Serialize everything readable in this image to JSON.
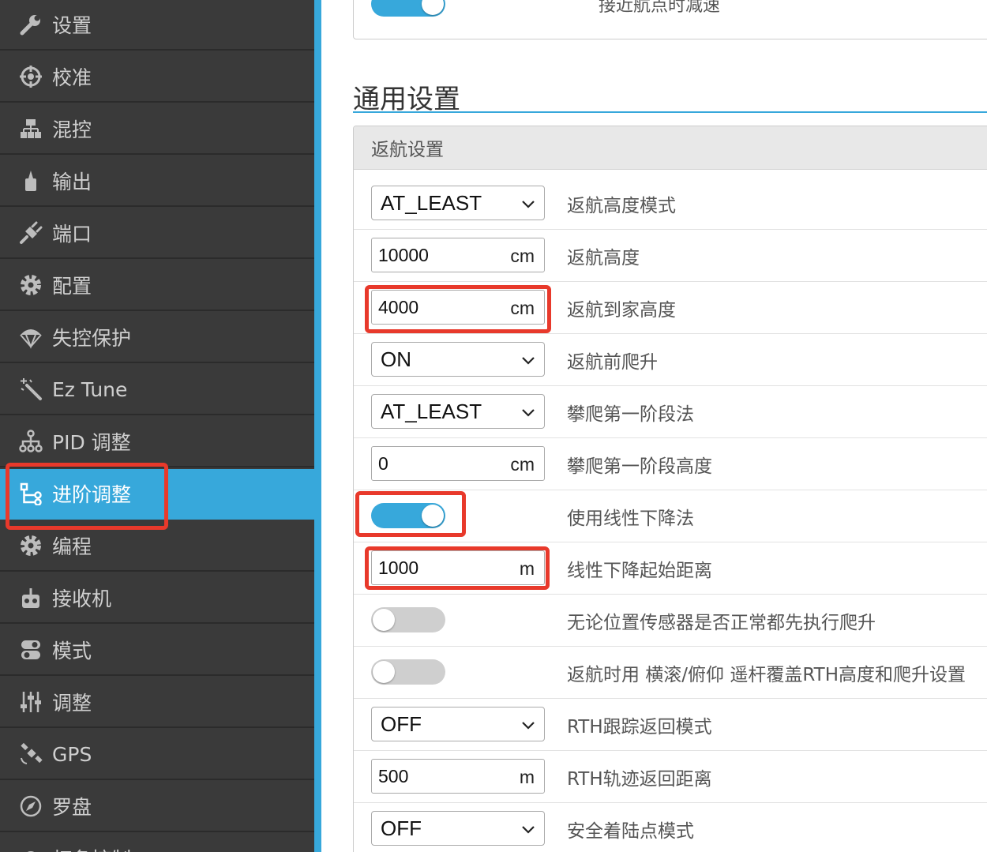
{
  "sidebar": {
    "items": [
      {
        "label": "设置",
        "icon": "wrench-icon"
      },
      {
        "label": "校准",
        "icon": "crosshair-icon"
      },
      {
        "label": "混控",
        "icon": "mixer-icon"
      },
      {
        "label": "输出",
        "icon": "motor-icon"
      },
      {
        "label": "端口",
        "icon": "plug-icon"
      },
      {
        "label": "配置",
        "icon": "gear-icon"
      },
      {
        "label": "失控保护",
        "icon": "parachute-icon"
      },
      {
        "label": "Ez Tune",
        "icon": "magic-wand-icon"
      },
      {
        "label": "PID 调整",
        "icon": "pid-tree-icon"
      },
      {
        "label": "进阶调整",
        "icon": "advanced-tuning-icon"
      },
      {
        "label": "编程",
        "icon": "gear-icon"
      },
      {
        "label": "接收机",
        "icon": "receiver-icon"
      },
      {
        "label": "模式",
        "icon": "toggle-switch-icon"
      },
      {
        "label": "调整",
        "icon": "sliders-icon"
      },
      {
        "label": "GPS",
        "icon": "satellite-icon"
      },
      {
        "label": "罗盘",
        "icon": "compass-icon"
      },
      {
        "label": "灯条控制",
        "icon": "led-icon"
      }
    ],
    "active_label": "进阶调整",
    "accent_color": "#37a8db"
  },
  "main": {
    "top_panel": {
      "label": "接近航点时减速",
      "toggle_state": "on"
    },
    "section_title": "通用设置",
    "panel": {
      "header": "返航设置",
      "rows": [
        {
          "type": "select",
          "value": "AT_LEAST",
          "label": "返航高度模式"
        },
        {
          "type": "number",
          "value": "10000",
          "unit": "cm",
          "label": "返航高度"
        },
        {
          "type": "number",
          "value": "4000",
          "unit": "cm",
          "label": "返航到家高度",
          "highlighted": true
        },
        {
          "type": "select",
          "value": "ON",
          "label": "返航前爬升"
        },
        {
          "type": "select",
          "value": "AT_LEAST",
          "label": "攀爬第一阶段法"
        },
        {
          "type": "number",
          "value": "0",
          "unit": "cm",
          "label": "攀爬第一阶段高度"
        },
        {
          "type": "toggle",
          "state": "on",
          "label": "使用线性下降法",
          "highlighted": true
        },
        {
          "type": "number",
          "value": "1000",
          "unit": "m",
          "label": "线性下降起始距离",
          "highlighted": true
        },
        {
          "type": "toggle",
          "state": "off",
          "label": "无论位置传感器是否正常都先执行爬升"
        },
        {
          "type": "toggle",
          "state": "off",
          "label": "返航时用 横滚/俯仰 遥杆覆盖RTH高度和爬升设置"
        },
        {
          "type": "select",
          "value": "OFF",
          "label": "RTH跟踪返回模式"
        },
        {
          "type": "number",
          "value": "500",
          "unit": "m",
          "label": "RTH轨迹返回距离"
        },
        {
          "type": "select",
          "value": "OFF",
          "label": "安全着陆点模式"
        }
      ]
    }
  },
  "colors": {
    "highlight": "#e8392b",
    "accent": "#37a8db",
    "sidebar_bg": "#3a3a3a"
  }
}
